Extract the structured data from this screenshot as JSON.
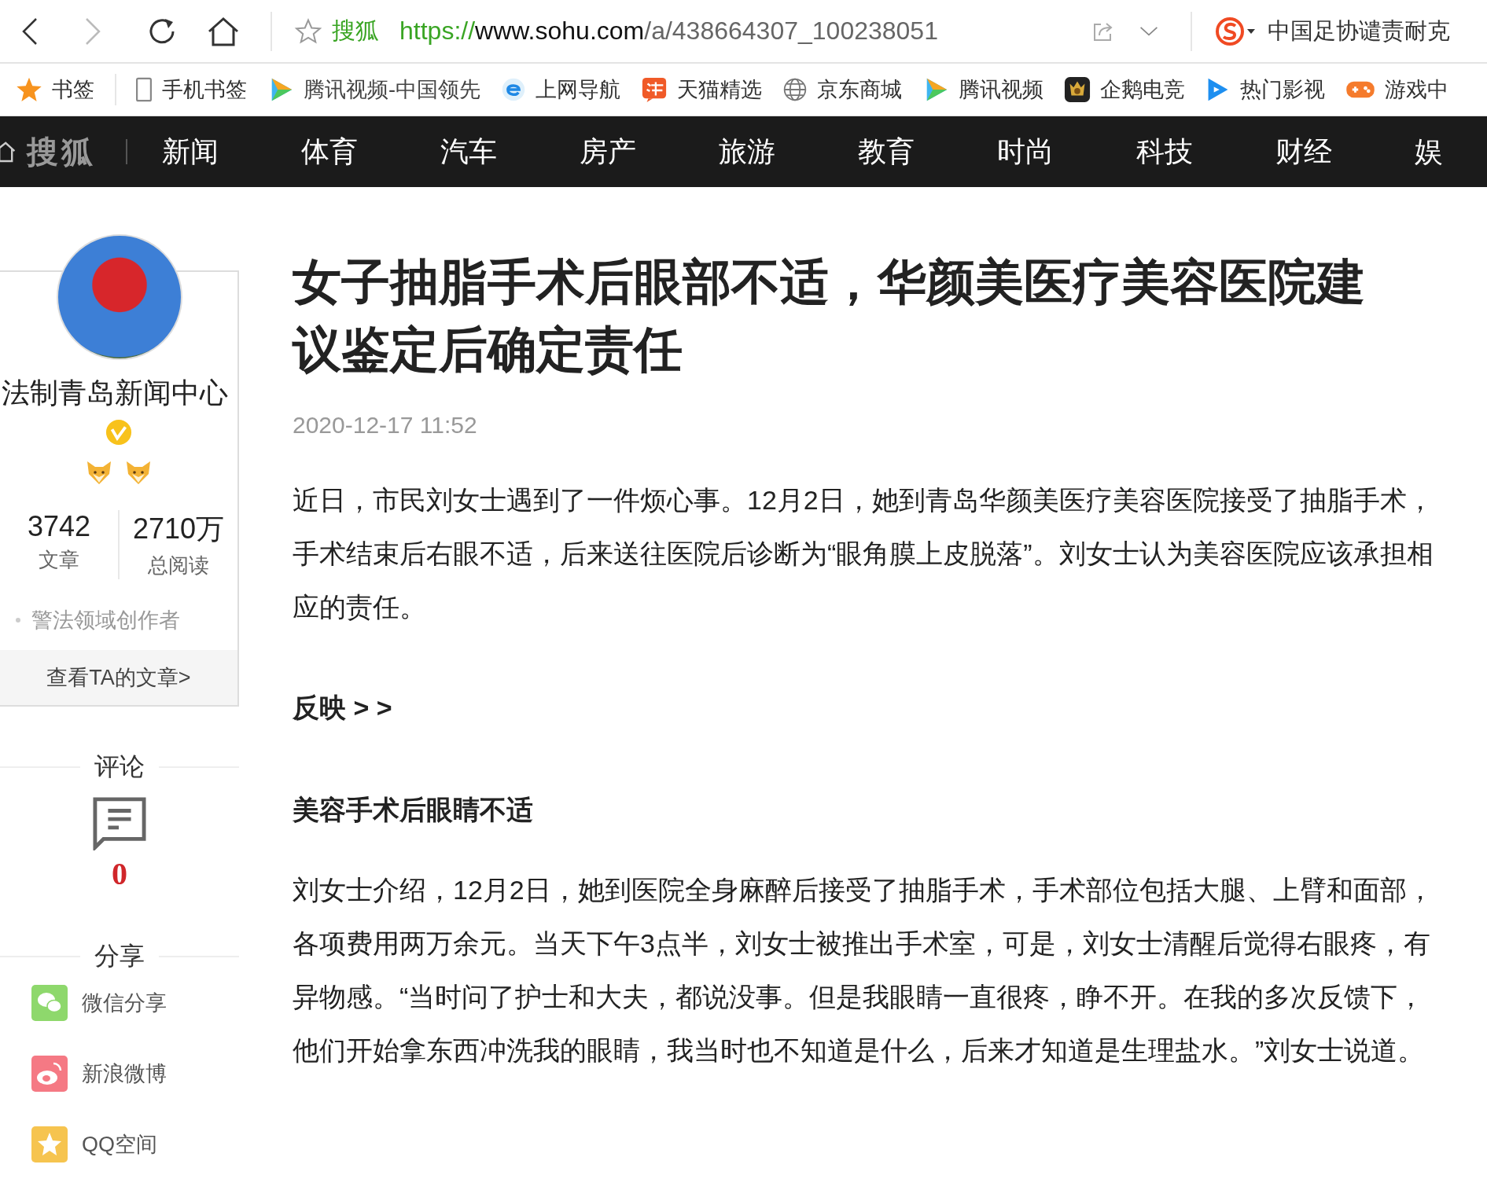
{
  "toolbar": {
    "site_label": "搜狐",
    "url": {
      "scheme": "https://",
      "host": "www.sohu.com",
      "path": "/a/438664307_100238051"
    },
    "search_text": "中国足协谴责耐克"
  },
  "bookmarks": [
    {
      "kind": "star",
      "label": "书签"
    },
    {
      "kind": "phone",
      "label": "手机书签"
    },
    {
      "kind": "video",
      "label": "腾讯视频-中国领先"
    },
    {
      "kind": "ie",
      "label": "上网导航"
    },
    {
      "kind": "tmall",
      "label": "天猫精选"
    },
    {
      "kind": "globe",
      "label": "京东商城"
    },
    {
      "kind": "video",
      "label": "腾讯视频"
    },
    {
      "kind": "shield",
      "label": "企鹅电竞"
    },
    {
      "kind": "play",
      "label": "热门影视"
    },
    {
      "kind": "game",
      "label": "游戏中"
    }
  ],
  "nav": {
    "logo": "搜狐",
    "items": [
      "新闻",
      "体育",
      "汽车",
      "房产",
      "旅游",
      "教育",
      "时尚",
      "科技",
      "财经",
      "娱"
    ]
  },
  "sidebar": {
    "author": "法制青岛新闻中心",
    "stats": [
      {
        "value": "3742",
        "label": "文章"
      },
      {
        "value": "2710万",
        "label": "总阅读"
      }
    ],
    "tag": "警法领域创作者",
    "more_button": "查看TA的文章>",
    "comments": {
      "heading": "评论",
      "count": "0"
    },
    "share": {
      "heading": "分享",
      "items": [
        {
          "kind": "wechat",
          "label": "微信分享"
        },
        {
          "kind": "weibo",
          "label": "新浪微博"
        },
        {
          "kind": "qzone",
          "label": "QQ空间"
        }
      ]
    }
  },
  "article": {
    "title": "女子抽脂手术后眼部不适，华颜美医疗美容医院建议鉴定后确定责任",
    "date": "2020-12-17 11:52",
    "blocks": [
      {
        "kind": "paragraph",
        "text": "近日，市民刘女士遇到了一件烦心事。12月2日，她到青岛华颜美医疗美容医院接受了抽脂手术，手术结束后右眼不适，后来送往医院后诊断为“眼角膜上皮脱落”。刘女士认为美容医院应该承担相应的责任。"
      },
      {
        "kind": "link",
        "text": "反映 > >"
      },
      {
        "kind": "subheading",
        "text": "美容手术后眼睛不适"
      },
      {
        "kind": "paragraph",
        "text": "刘女士介绍，12月2日，她到医院全身麻醉后接受了抽脂手术，手术部位包括大腿、上臂和面部，各项费用两万余元。当天下午3点半，刘女士被推出手术室，可是，刘女士清醒后觉得右眼疼，有异物感。“当时问了护士和大夫，都说没事。但是我眼睛一直很疼，睁不开。在我的多次反馈下，他们开始拿东西冲洗我的眼睛，我当时也不知道是什么，后来才知道是生理盐水。”刘女士说道。"
      }
    ]
  }
}
